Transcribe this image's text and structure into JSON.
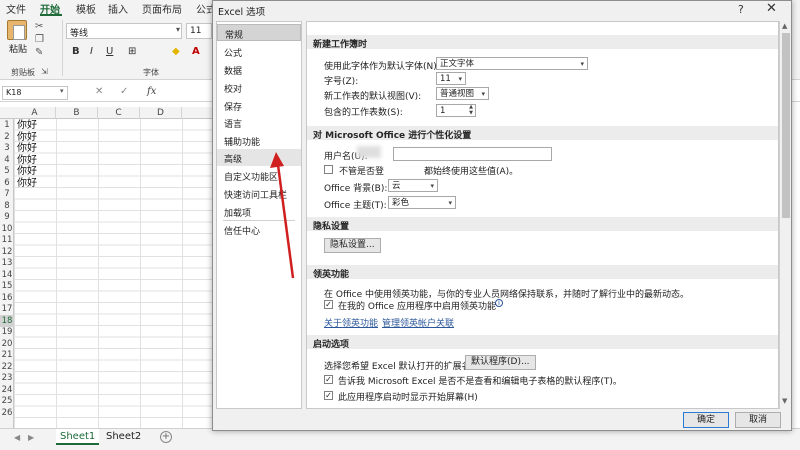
{
  "ribbon": {
    "tabs": [
      "文件",
      "开始",
      "模板",
      "插入",
      "页面布局",
      "公式"
    ],
    "paste_label": "粘贴",
    "clipboard_label": "剪贴板",
    "font_group_label": "字体",
    "font_name": "等线",
    "font_size": "11",
    "format_buttons": [
      "B",
      "I",
      "U"
    ]
  },
  "formula_bar": {
    "name_box": "K18",
    "fx": "fx"
  },
  "sheet": {
    "columns": [
      "A",
      "B",
      "C",
      "D"
    ],
    "rows": [
      "1",
      "2",
      "3",
      "4",
      "5",
      "6",
      "7",
      "8",
      "9",
      "10",
      "11",
      "12",
      "13",
      "14",
      "15",
      "16",
      "17",
      "18",
      "19",
      "20",
      "21",
      "22",
      "23",
      "24",
      "25",
      "26"
    ],
    "selected_row": "18",
    "cells_A": [
      "你好",
      "你好",
      "你好",
      "你好",
      "你好",
      "你好"
    ],
    "tabs": [
      "Sheet1",
      "Sheet2"
    ],
    "active_tab": "Sheet1"
  },
  "dialog": {
    "title": "Excel 选项",
    "help": "?",
    "close": "✕",
    "nav": [
      "常规",
      "公式",
      "数据",
      "校对",
      "保存",
      "语言",
      "辅助功能",
      "高级",
      "自定义功能区",
      "快速访问工具栏",
      "加载项",
      "信任中心"
    ],
    "selected_nav": "常规",
    "hover_nav": "高级",
    "sections": {
      "new_workbook": {
        "header": "新建工作簿时",
        "default_font_label": "使用此字体作为默认字体(N):",
        "default_font_value": "正文字体",
        "font_size_label": "字号(Z):",
        "font_size_value": "11",
        "default_view_label": "新工作表的默认视图(V):",
        "default_view_value": "普通视图",
        "sheet_count_label": "包含的工作表数(S):",
        "sheet_count_value": "1"
      },
      "personalize": {
        "header": "对 Microsoft Office 进行个性化设置",
        "username_label": "用户名(U):",
        "always_use_prefix": "不管是否登",
        "always_use_suffix": "都始终使用这些值(A)。",
        "background_label": "Office 背景(B):",
        "background_value": "云",
        "theme_label": "Office 主题(T):",
        "theme_value": "彩色"
      },
      "privacy": {
        "header": "隐私设置",
        "button": "隐私设置..."
      },
      "linkedin": {
        "header": "领英功能",
        "description": "在 Office 中使用领英功能，与你的专业人员网络保持联系，并随时了解行业中的最新动态。",
        "enable_label": "在我的 Office 应用程序中启用领英功能",
        "link_about": "关于领英功能",
        "link_manage": "管理领英帐户关联"
      },
      "startup": {
        "header": "启动选项",
        "extensions_label": "选择您希望 Excel 默认打开的扩展名:",
        "default_programs_button": "默认程序(D)...",
        "tell_me_label": "告诉我 Microsoft Excel 是否不是查看和编辑电子表格的默认程序(T)。",
        "start_screen_label": "此应用程序启动时显示开始屏幕(H)"
      }
    },
    "ok_button": "确定",
    "cancel_button": "取消"
  },
  "colors": {
    "accent_green": "#1e6a39",
    "annotation_arrow": "#d01f1f"
  }
}
